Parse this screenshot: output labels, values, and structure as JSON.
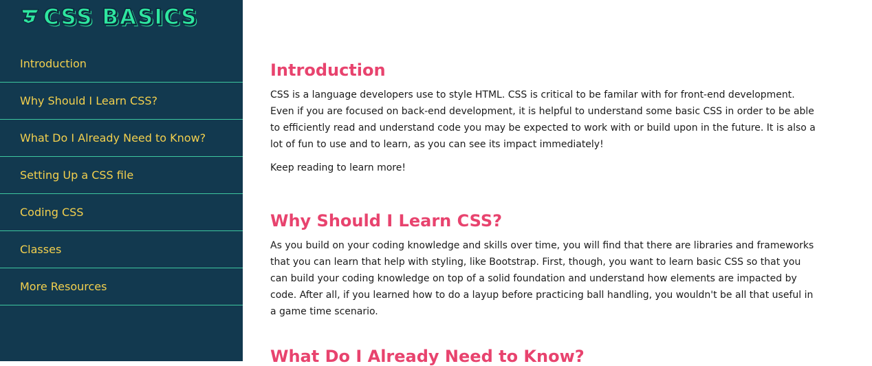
{
  "logo": {
    "text": "CSS BASICS",
    "icon": "css3-logo-icon",
    "color": "#2ee6a0"
  },
  "sidebar": {
    "background": "#12394f",
    "link_color": "#f3d04e",
    "divider_color": "#3ec8a0",
    "items": [
      {
        "label": "Introduction"
      },
      {
        "label": "Why Should I Learn CSS?"
      },
      {
        "label": "What Do I Already Need to Know?"
      },
      {
        "label": "Setting Up a CSS file"
      },
      {
        "label": "Coding CSS"
      },
      {
        "label": "Classes"
      },
      {
        "label": "More Resources"
      }
    ]
  },
  "main": {
    "heading_color": "#e8436e",
    "sections": [
      {
        "title": "Introduction",
        "paragraphs": [
          "CSS is a language developers use to style HTML. CSS is critical to be familar with for front-end development. Even if you are focused on back-end development, it is helpful to understand some basic CSS in order to be able to efficiently read and understand code you may be expected to work with or build upon in the future. It is also a lot of fun to use and to learn, as you can see its impact immediately!",
          "Keep reading to learn more!"
        ]
      },
      {
        "title": "Why Should I Learn CSS?",
        "paragraphs": [
          "As you build on your coding knowledge and skills over time, you will find that there are libraries and frameworks that you can learn that help with styling, like Bootstrap. First, though, you want to learn basic CSS so that you can build your coding knowledge on top of a solid foundation and understand how elements are impacted by code. After all, if you learned how to do a layup before practicing ball handling, you wouldn't be all that useful in a game time scenario."
        ]
      },
      {
        "title": "What Do I Already Need to Know?",
        "paragraphs": []
      }
    ]
  }
}
